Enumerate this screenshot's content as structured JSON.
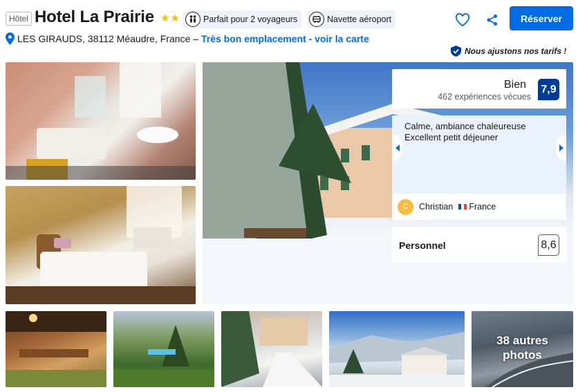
{
  "header": {
    "property_type": "Hôtel",
    "title": "Hotel La Prairie",
    "star_count": 2,
    "star_color": "#febb02",
    "badges": [
      {
        "icon": "people-icon",
        "label": "Parfait pour 2 voyageurs"
      },
      {
        "icon": "shuttle-icon",
        "label": "Navette aéroport"
      }
    ],
    "reserve_label": "Réserver",
    "accent_color": "#006ce4"
  },
  "address": {
    "text": "LES GIRAUDS, 38112 Méaudre, France –",
    "map_link": "Très bon emplacement - voir la carte"
  },
  "price_note": "Nous ajustons nos tarifs !",
  "rating": {
    "word": "Bien",
    "count_text": "462 expériences vécues",
    "score": "7,9"
  },
  "review": {
    "text_line1": "Calme, ambiance chaleureuse",
    "text_line2": "Excellent petit déjeuner",
    "avatar_letter": "C",
    "reviewer_name": "Christian",
    "reviewer_country": "France"
  },
  "staff": {
    "label": "Personnel",
    "score": "8,6"
  },
  "gallery": {
    "more_photos_line1": "38 autres",
    "more_photos_line2": "photos"
  }
}
